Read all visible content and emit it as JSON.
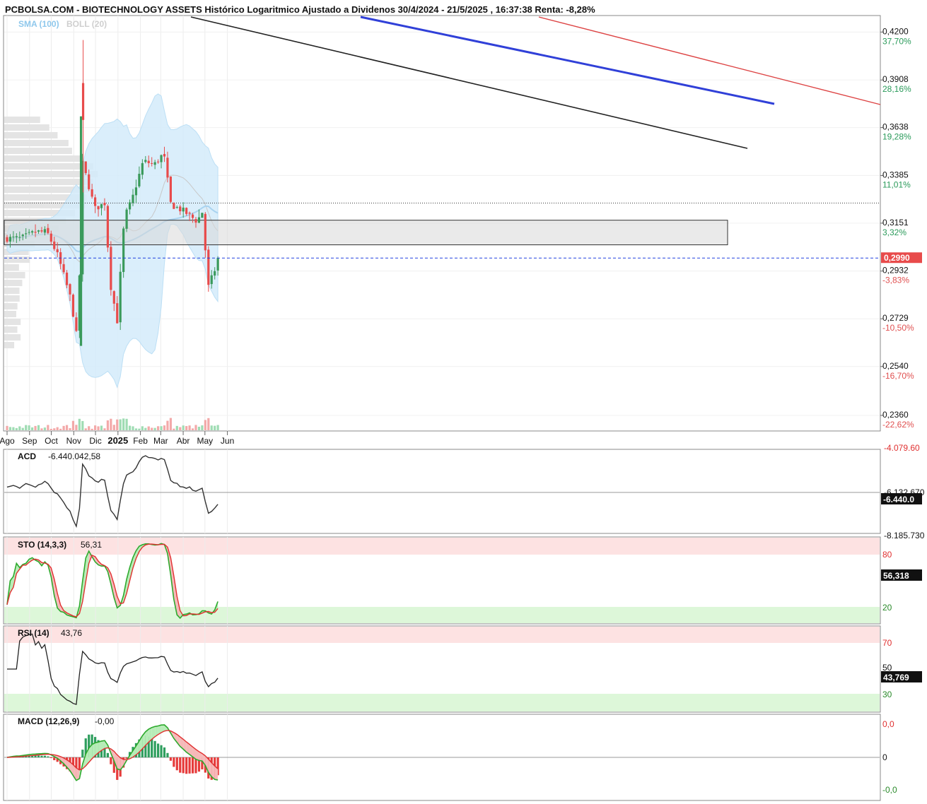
{
  "header": {
    "title": "PCBOLSA.COM - BIOTECHNOLOGY ASSETS Histórico Logaritmico Ajustado a Dividenos 30/4/2024 - 21/5/2025 , 16:37:38 Renta: -8,28%",
    "sma_label": "SMA (100)",
    "boll_label": "BOLL (20)"
  },
  "colors": {
    "up": "#3a9a5b",
    "down": "#e84b4b",
    "boll_fill": "#cfe8f8",
    "sma": "#a9d3f0",
    "trend_black": "#222222",
    "trend_blue": "#3040d8",
    "trend_red": "#dd4444",
    "last_price": "#2040e0"
  },
  "price_axis": {
    "levels": [
      {
        "price": "0,4200",
        "pct": "37,70%",
        "tone": "up"
      },
      {
        "price": "0,3908",
        "pct": "28,16%",
        "tone": "up"
      },
      {
        "price": "0,3638",
        "pct": "19,28%",
        "tone": "up"
      },
      {
        "price": "0,3385",
        "pct": "11,01%",
        "tone": "up"
      },
      {
        "price": "0,3151",
        "pct": "3,32%",
        "tone": "up"
      },
      {
        "price": "0,2932",
        "pct": "-3,83%",
        "tone": "down"
      },
      {
        "price": "0,2729",
        "pct": "-10,50%",
        "tone": "down"
      },
      {
        "price": "0,2540",
        "pct": "-16,70%",
        "tone": "down"
      },
      {
        "price": "0,2360",
        "pct": "-22,62%",
        "tone": "down"
      }
    ],
    "last_price": "0,2990"
  },
  "x_axis": {
    "months": [
      "Ago",
      "Sep",
      "Oct",
      "Nov",
      "Dic",
      "2025",
      "Feb",
      "Mar",
      "Abr",
      "May",
      "Jun"
    ]
  },
  "panels": {
    "acd": {
      "label": "ACD",
      "value": "-6.440.042,58",
      "top_label": "-4.079.60",
      "mid_label": "-6.132.670",
      "bottom_label": "-8.185.730",
      "badge": "-6.440.0"
    },
    "sto": {
      "label": "STO (14,3,3)",
      "value": "56,31",
      "upper_level": "80",
      "lower_level": "20",
      "badge": "56,318"
    },
    "rsi": {
      "label": "RSI (14)",
      "value": "43,76",
      "upper_level": "70",
      "mid_level": "50",
      "lower_level": "30",
      "badge": "43,769"
    },
    "macd": {
      "label": "MACD (12,26,9)",
      "value": "-0,00",
      "top_label": "0,0",
      "mid_label": "0",
      "bottom_label": "-0,0"
    }
  },
  "chart_data": {
    "type": "candlestick",
    "title": "PCBOLSA.COM - BIOTECHNOLOGY ASSETS Histórico Logaritmico Ajustado a Dividenos 30/4/2024 - 21/5/2025 , 16:37:38 Renta: -8,28%",
    "y_scale": "log",
    "ylim": [
      0.233,
      0.426
    ],
    "last_close": 0.299,
    "period": "30/4/2024 - 21/5/2025",
    "x_ticks": [
      "Ago",
      "Sep",
      "Oct",
      "Nov",
      "Dic",
      "2025",
      "Feb",
      "Mar",
      "Abr",
      "May",
      "Jun"
    ],
    "close_anchors": [
      {
        "d": "2024-08-01",
        "v": 0.308
      },
      {
        "d": "2024-08-20",
        "v": 0.308
      },
      {
        "d": "2024-09-10",
        "v": 0.311
      },
      {
        "d": "2024-09-25",
        "v": 0.311
      },
      {
        "d": "2024-10-10",
        "v": 0.3
      },
      {
        "d": "2024-10-28",
        "v": 0.281
      },
      {
        "d": "2024-11-08",
        "v": 0.26
      },
      {
        "d": "2024-11-11",
        "v": 0.37
      },
      {
        "d": "2024-11-13",
        "v": 0.345
      },
      {
        "d": "2024-11-30",
        "v": 0.322
      },
      {
        "d": "2024-12-15",
        "v": 0.325
      },
      {
        "d": "2024-12-20",
        "v": 0.29
      },
      {
        "d": "2024-12-31",
        "v": 0.272
      },
      {
        "d": "2025-01-10",
        "v": 0.318
      },
      {
        "d": "2025-01-20",
        "v": 0.326
      },
      {
        "d": "2025-02-05",
        "v": 0.346
      },
      {
        "d": "2025-02-20",
        "v": 0.344
      },
      {
        "d": "2025-03-05",
        "v": 0.35
      },
      {
        "d": "2025-03-15",
        "v": 0.324
      },
      {
        "d": "2025-04-01",
        "v": 0.321
      },
      {
        "d": "2025-04-20",
        "v": 0.316
      },
      {
        "d": "2025-04-30",
        "v": 0.322
      },
      {
        "d": "2025-05-03",
        "v": 0.284
      },
      {
        "d": "2025-05-21",
        "v": 0.299
      }
    ],
    "support_zone": [
      0.305,
      0.3165
    ],
    "resistance_dotted": 0.3248,
    "indicators": [
      "SMA (100)",
      "BOLL (20)",
      "ACD",
      "STO (14,3,3)",
      "RSI (14)",
      "MACD (12,26,9)"
    ]
  }
}
